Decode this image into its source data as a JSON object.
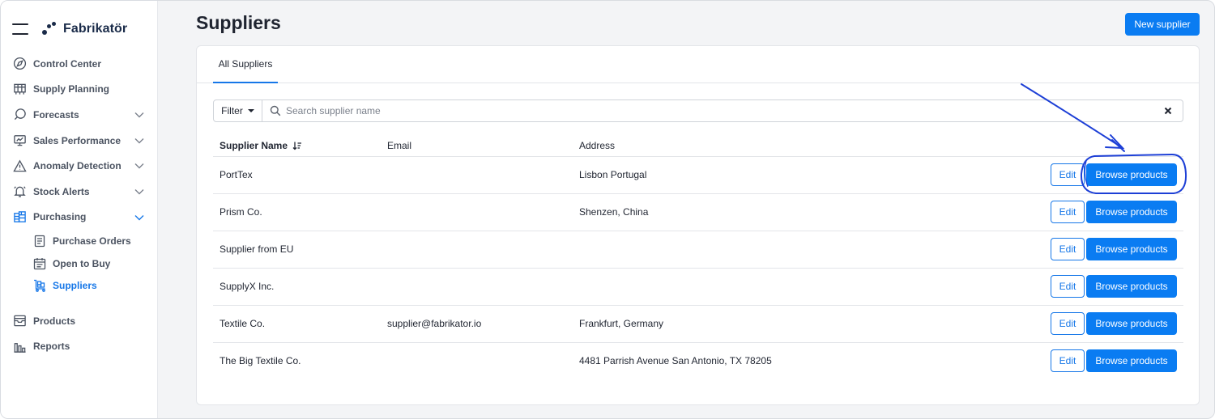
{
  "app": {
    "brand_name": "Fabrikatör"
  },
  "sidebar": {
    "items": [
      {
        "label": "Control Center",
        "icon": "compass-icon"
      },
      {
        "label": "Supply Planning",
        "icon": "grid-icon"
      },
      {
        "label": "Forecasts",
        "icon": "chat-bubble-icon",
        "expandable": true
      },
      {
        "label": "Sales Performance",
        "icon": "monitor-icon",
        "expandable": true
      },
      {
        "label": "Anomaly Detection",
        "icon": "warning-icon",
        "expandable": true
      },
      {
        "label": "Stock Alerts",
        "icon": "bell-icon",
        "expandable": true
      },
      {
        "label": "Purchasing",
        "icon": "boxes-icon",
        "expandable": true,
        "expanded": true
      }
    ],
    "purchasing_children": [
      {
        "label": "Purchase Orders",
        "icon": "document-icon"
      },
      {
        "label": "Open to Buy",
        "icon": "calendar-icon"
      },
      {
        "label": "Suppliers",
        "icon": "cart-icon",
        "active": true
      }
    ],
    "bottom_items": [
      {
        "label": "Products",
        "icon": "inbox-icon"
      },
      {
        "label": "Reports",
        "icon": "bar-chart-icon"
      }
    ]
  },
  "page": {
    "title": "Suppliers",
    "new_supplier_label": "New supplier",
    "tabs": [
      {
        "label": "All Suppliers",
        "active": true
      }
    ]
  },
  "filter": {
    "filter_label": "Filter",
    "search_placeholder": "Search supplier name",
    "search_value": ""
  },
  "table": {
    "columns": [
      "Supplier Name",
      "Email",
      "Address"
    ],
    "sorted_column": "Supplier Name",
    "edit_label": "Edit",
    "browse_label": "Browse products",
    "rows": [
      {
        "name": "PortTex",
        "email": "",
        "address": "Lisbon Portugal"
      },
      {
        "name": "Prism Co.",
        "email": "",
        "address": "Shenzen, China"
      },
      {
        "name": "Supplier from EU",
        "email": "",
        "address": ""
      },
      {
        "name": "SupplyX Inc.",
        "email": "",
        "address": ""
      },
      {
        "name": "Textile Co.",
        "email": "supplier@fabrikator.io",
        "address": "Frankfurt, Germany"
      },
      {
        "name": "The Big Textile Co.",
        "email": "",
        "address": "4481 Parrish Avenue San Antonio, TX 78205"
      }
    ]
  },
  "colors": {
    "accent": "#0a7cf2",
    "active_nav": "#1677e8",
    "annotation": "#1d3fd6"
  }
}
